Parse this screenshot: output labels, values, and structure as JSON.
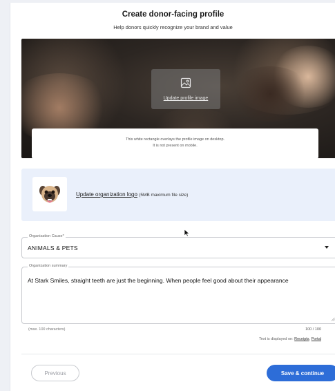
{
  "header": {
    "title": "Create donor-facing profile",
    "subtitle": "Help donors quickly recognize your brand and value"
  },
  "profile_image": {
    "upload_label": "Update profile image",
    "overlay_note_line1": "This white rectangle overlays the profile image on desktop.",
    "overlay_note_line2": "It is not present on mobile."
  },
  "logo": {
    "link_label": "Update organization logo",
    "size_note": "(5MB maximum file size)"
  },
  "cause": {
    "label": "Organization Cause*",
    "value": "ANIMALS & PETS"
  },
  "summary": {
    "label": "Organization summary",
    "value": "At Stark Smiles, straight teeth are just the beginning. When people feel good about their appearance",
    "hint": "(max. 100 characters)",
    "counter": "100 / 100",
    "displayed_on_label": "Text is displayed on:",
    "receipts_link": "Receipts",
    "portal_link": "Portal"
  },
  "footer": {
    "previous_label": "Previous",
    "save_label": "Save & continue"
  },
  "colors": {
    "accent": "#2d6dd8",
    "logo_panel_bg": "#eaf0fb"
  }
}
